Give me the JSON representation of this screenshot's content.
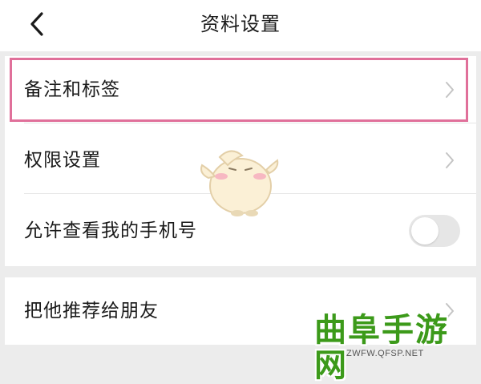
{
  "header": {
    "title": "资料设置",
    "back_icon": "chevron-left-icon"
  },
  "settings": {
    "remark_and_tags": {
      "label": "备注和标签",
      "icon": "chevron-right-icon"
    },
    "permissions": {
      "label": "权限设置",
      "icon": "chevron-right-icon"
    },
    "allow_view_phone": {
      "label": "允许查看我的手机号",
      "toggle_on": false
    },
    "recommend_to_friends": {
      "label": "把他推荐给朋友",
      "icon": "chevron-right-icon"
    }
  },
  "highlight": {
    "target": "remark_and_tags",
    "color": "#e0709a"
  },
  "watermark": {
    "logo_text": "曲阜手游网",
    "url_text": "ZWFW.QFSP.NET",
    "logo_color": "#3c9a1a"
  },
  "colors": {
    "background": "#ececec",
    "card": "#ffffff",
    "divider": "#e6e6e6",
    "chevron": "#c4c4c4"
  }
}
